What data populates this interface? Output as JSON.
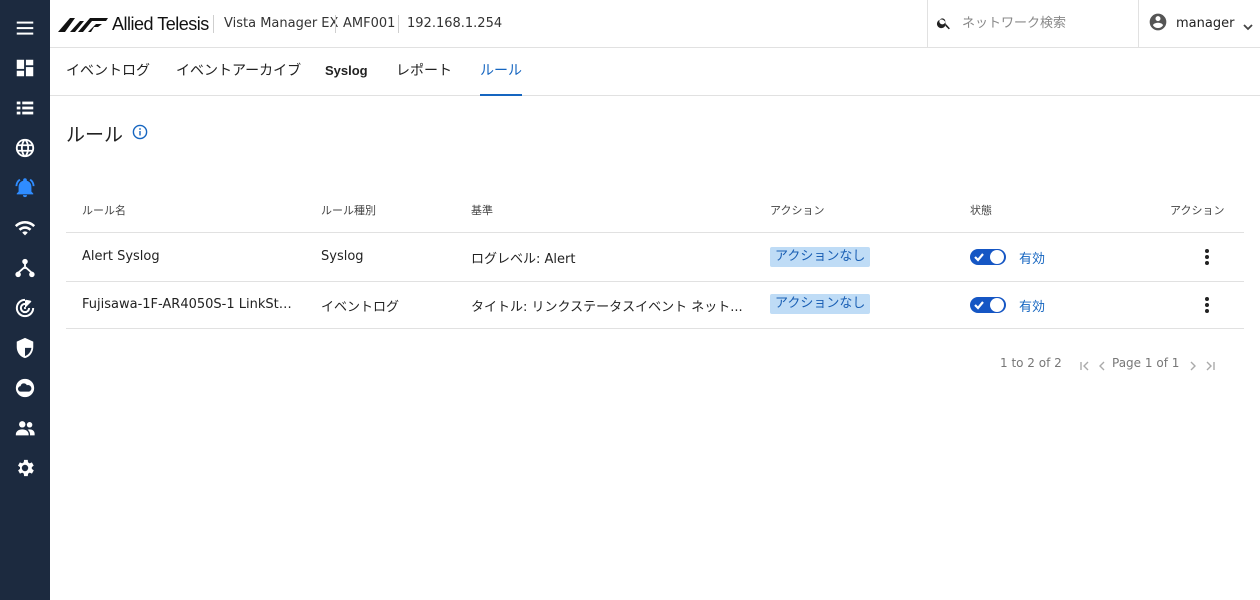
{
  "brand": {
    "logo_text": "Allied Telesis",
    "accent": "#1565c0",
    "sidebar_bg": "#1c2a3f"
  },
  "breadcrumb": {
    "product": "Vista Manager EX",
    "area": "AMF001",
    "ip": "192.168.1.254"
  },
  "search": {
    "placeholder": "ネットワーク検索",
    "value": ""
  },
  "user": {
    "name": "manager"
  },
  "sidebar": {
    "items": [
      {
        "icon": "menu-icon"
      },
      {
        "icon": "dashboard-icon"
      },
      {
        "icon": "list-icon"
      },
      {
        "icon": "globe-icon"
      },
      {
        "icon": "bell-icon",
        "active": true
      },
      {
        "icon": "wifi-icon"
      },
      {
        "icon": "network-icon"
      },
      {
        "icon": "radar-icon"
      },
      {
        "icon": "shield-icon"
      },
      {
        "icon": "cloud-icon"
      },
      {
        "icon": "users-icon"
      },
      {
        "icon": "gear-icon"
      }
    ]
  },
  "tabs": [
    {
      "label": "イベントログ"
    },
    {
      "label": "イベントアーカイブ"
    },
    {
      "label": "Syslog"
    },
    {
      "label": "レポート"
    },
    {
      "label": "ルール",
      "active": true
    }
  ],
  "page": {
    "title": "ルール"
  },
  "table": {
    "headers": [
      "ルール名",
      "ルール種別",
      "基準",
      "アクション",
      "状態",
      "アクション"
    ],
    "rows": [
      {
        "name": "Alert Syslog",
        "type": "Syslog",
        "criteria": "ログレベル: Alert",
        "action": "アクションなし",
        "status": "有効",
        "enabled": true
      },
      {
        "name": "Fujisawa-1F-AR4050S-1 LinkStatu...",
        "type": "イベントログ",
        "criteria": "タイトル: リンクステータスイベント ネット...",
        "action": "アクションなし",
        "status": "有効",
        "enabled": true
      }
    ]
  },
  "pagination": {
    "range": "1 to 2 of 2",
    "page_label": "Page",
    "page": "1",
    "of_label": "of",
    "total": "1"
  }
}
